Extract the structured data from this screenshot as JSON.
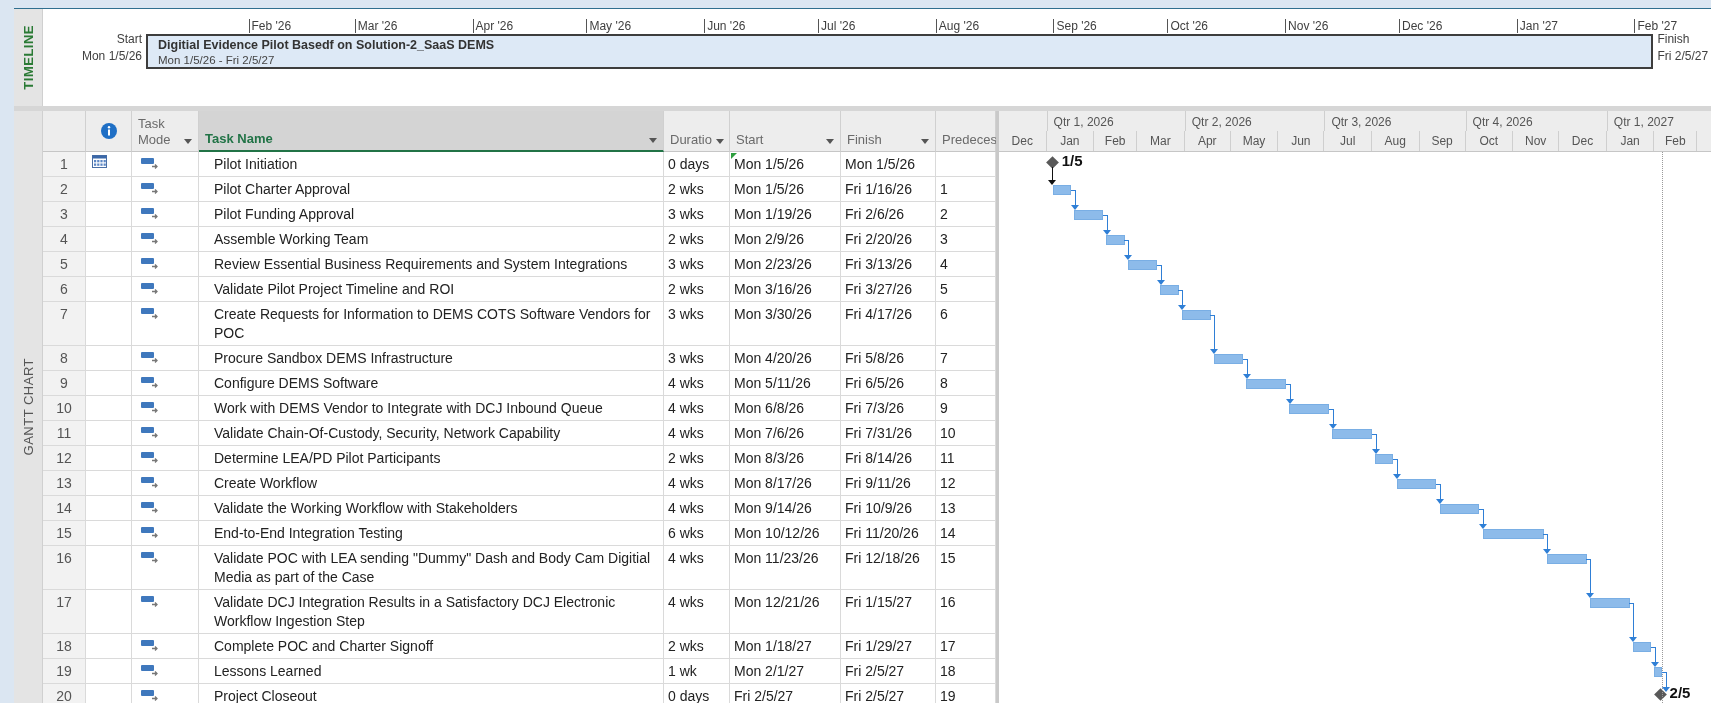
{
  "timeline": {
    "label": "TIMELINE",
    "start_label": "Start",
    "start_date": "Mon 1/5/26",
    "finish_label": "Finish",
    "finish_date": "Fri 2/5/27",
    "ticks": [
      "Feb '26",
      "Mar '26",
      "Apr '26",
      "May '26",
      "Jun '26",
      "Jul '26",
      "Aug '26",
      "Sep '26",
      "Oct '26",
      "Nov '26",
      "Dec '26",
      "Jan '27",
      "Feb '27"
    ],
    "bar": {
      "title": "Digitial Evidence Pilot Basedf on Solution-2_SaaS DEMS",
      "dates": "Mon 1/5/26 - Fri 2/5/27"
    }
  },
  "view_label": "GANTT CHART",
  "table": {
    "columns": [
      {
        "kind": "info",
        "selected": false
      },
      {
        "kind": "text",
        "label": "Task Mode",
        "dropdown": true,
        "selected": false
      },
      {
        "kind": "text",
        "label": "Task Name",
        "dropdown": true,
        "selected": true
      },
      {
        "kind": "text",
        "label": "Duratio",
        "dropdown": true,
        "selected": false
      },
      {
        "kind": "text",
        "label": "Start",
        "dropdown": true,
        "selected": false
      },
      {
        "kind": "text",
        "label": "Finish",
        "dropdown": true,
        "selected": false
      },
      {
        "kind": "text",
        "label": "Predeces",
        "selected": false
      }
    ],
    "rows": [
      {
        "id": "1",
        "kind": "milestone",
        "calendar_indicator": true,
        "start_flag": true,
        "name": "Pilot Initiation",
        "duration": "0 days",
        "start": "Mon 1/5/26",
        "finish": "Mon 1/5/26",
        "gantt_label": "1/5"
      },
      {
        "id": "2",
        "kind": "task",
        "calendar_indicator": false,
        "start_flag": false,
        "name": "Pilot Charter Approval",
        "duration": "2 wks",
        "start": "Mon 1/5/26",
        "finish": "Fri 1/16/26",
        "predecessors": "1"
      },
      {
        "id": "3",
        "kind": "task",
        "calendar_indicator": false,
        "start_flag": false,
        "name": "Pilot Funding Approval",
        "duration": "3 wks",
        "start": "Mon 1/19/26",
        "finish": "Fri 2/6/26",
        "predecessors": "2"
      },
      {
        "id": "4",
        "kind": "task",
        "calendar_indicator": false,
        "start_flag": false,
        "name": "Assemble Working Team",
        "duration": "2 wks",
        "start": "Mon 2/9/26",
        "finish": "Fri 2/20/26",
        "predecessors": "3"
      },
      {
        "id": "5",
        "kind": "task",
        "calendar_indicator": false,
        "start_flag": false,
        "name": "Review Essential Business Requirements and System Integrations",
        "duration": "3 wks",
        "start": "Mon 2/23/26",
        "finish": "Fri 3/13/26",
        "predecessors": "4"
      },
      {
        "id": "6",
        "kind": "task",
        "calendar_indicator": false,
        "start_flag": false,
        "name": "Validate Pilot Project Timeline and ROI",
        "duration": "2 wks",
        "start": "Mon 3/16/26",
        "finish": "Fri 3/27/26",
        "predecessors": "5"
      },
      {
        "id": "7",
        "kind": "task",
        "calendar_indicator": false,
        "start_flag": false,
        "name": "Create Requests for Information to DEMS COTS Software Vendors for POC",
        "duration": "3 wks",
        "start": "Mon 3/30/26",
        "finish": "Fri 4/17/26",
        "predecessors": "6"
      },
      {
        "id": "8",
        "kind": "task",
        "calendar_indicator": false,
        "start_flag": false,
        "name": "Procure Sandbox DEMS Infrastructure",
        "duration": "3 wks",
        "start": "Mon 4/20/26",
        "finish": "Fri 5/8/26",
        "predecessors": "7"
      },
      {
        "id": "9",
        "kind": "task",
        "calendar_indicator": false,
        "start_flag": false,
        "name": "Configure DEMS Software",
        "duration": "4 wks",
        "start": "Mon 5/11/26",
        "finish": "Fri 6/5/26",
        "predecessors": "8"
      },
      {
        "id": "10",
        "kind": "task",
        "calendar_indicator": false,
        "start_flag": false,
        "name": "Work with DEMS Vendor to Integrate with DCJ Inbound Queue",
        "duration": "4 wks",
        "start": "Mon 6/8/26",
        "finish": "Fri 7/3/26",
        "predecessors": "9"
      },
      {
        "id": "11",
        "kind": "task",
        "calendar_indicator": false,
        "start_flag": false,
        "name": "Validate Chain-Of-Custody, Security, Network Capability",
        "duration": "4 wks",
        "start": "Mon 7/6/26",
        "finish": "Fri 7/31/26",
        "predecessors": "10"
      },
      {
        "id": "12",
        "kind": "task",
        "calendar_indicator": false,
        "start_flag": false,
        "name": "Determine LEA/PD Pilot Participants",
        "duration": "2 wks",
        "start": "Mon 8/3/26",
        "finish": "Fri 8/14/26",
        "predecessors": "11"
      },
      {
        "id": "13",
        "kind": "task",
        "calendar_indicator": false,
        "start_flag": false,
        "name": "Create Workflow",
        "duration": "4 wks",
        "start": "Mon 8/17/26",
        "finish": "Fri 9/11/26",
        "predecessors": "12"
      },
      {
        "id": "14",
        "kind": "task",
        "calendar_indicator": false,
        "start_flag": false,
        "name": "Validate the Working Workflow with Stakeholders",
        "duration": "4 wks",
        "start": "Mon 9/14/26",
        "finish": "Fri 10/9/26",
        "predecessors": "13"
      },
      {
        "id": "15",
        "kind": "task",
        "calendar_indicator": false,
        "start_flag": false,
        "name": "End-to-End Integration Testing",
        "duration": "6 wks",
        "start": "Mon 10/12/26",
        "finish": "Fri 11/20/26",
        "predecessors": "14"
      },
      {
        "id": "16",
        "kind": "task",
        "calendar_indicator": false,
        "start_flag": false,
        "name": "Validate POC with LEA sending \"Dummy\" Dash and Body Cam Digitial Media as part of the Case",
        "duration": "4 wks",
        "start": "Mon 11/23/26",
        "finish": "Fri 12/18/26",
        "predecessors": "15"
      },
      {
        "id": "17",
        "kind": "task",
        "calendar_indicator": false,
        "start_flag": false,
        "name": "Validate DCJ Integration Results in a Satisfactory DCJ Electronic Workflow Ingestion Step",
        "duration": "4 wks",
        "start": "Mon 12/21/26",
        "finish": "Fri 1/15/27",
        "predecessors": "16"
      },
      {
        "id": "18",
        "kind": "task",
        "calendar_indicator": false,
        "start_flag": false,
        "name": "Complete POC and Charter Signoff",
        "duration": "2 wks",
        "start": "Mon 1/18/27",
        "finish": "Fri 1/29/27",
        "predecessors": "17"
      },
      {
        "id": "19",
        "kind": "task",
        "calendar_indicator": false,
        "start_flag": false,
        "name": "Lessons Learned",
        "duration": "1 wk",
        "start": "Mon 2/1/27",
        "finish": "Fri 2/5/27",
        "predecessors": "18"
      },
      {
        "id": "20",
        "kind": "milestone",
        "calendar_indicator": false,
        "start_flag": false,
        "name": "Project Closeout",
        "duration": "0 days",
        "start": "Fri 2/5/27",
        "finish": "Fri 2/5/27",
        "predecessors": "19",
        "gantt_label": "2/5"
      }
    ]
  },
  "gantt": {
    "quarters": [
      "Qtr 1, 2026",
      "Qtr 2, 2026",
      "Qtr 3, 2026",
      "Qtr 4, 2026",
      "Qtr 1, 2027"
    ],
    "months": [
      "Dec",
      "Jan",
      "Feb",
      "Mar",
      "Apr",
      "May",
      "Jun",
      "Jul",
      "Aug",
      "Sep",
      "Oct",
      "Nov",
      "Dec",
      "Jan",
      "Feb"
    ]
  }
}
